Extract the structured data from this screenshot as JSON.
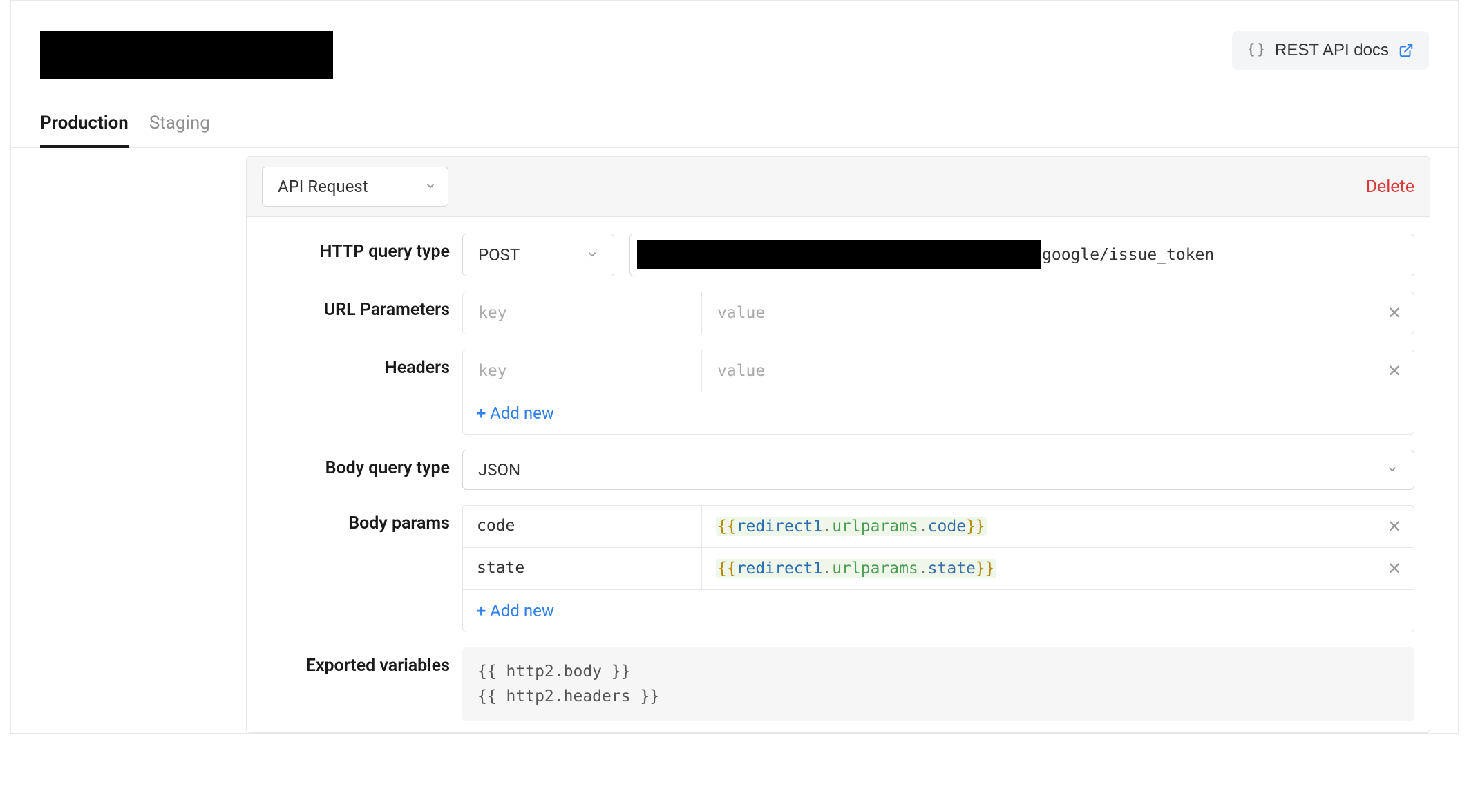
{
  "header": {
    "docs_label": "REST API docs"
  },
  "tabs": [
    {
      "label": "Production",
      "active": true
    },
    {
      "label": "Staging",
      "active": false
    }
  ],
  "panel": {
    "type_selector": "API Request",
    "delete_label": "Delete",
    "rows": {
      "http_query_type": {
        "label": "HTTP query type",
        "method": "POST",
        "url_suffix": "google/issue_token"
      },
      "url_parameters": {
        "label": "URL Parameters",
        "items": [
          {
            "key": "",
            "value": ""
          }
        ],
        "key_placeholder": "key",
        "value_placeholder": "value"
      },
      "headers": {
        "label": "Headers",
        "items": [
          {
            "key": "",
            "value": ""
          }
        ],
        "key_placeholder": "key",
        "value_placeholder": "value",
        "add_new_label": "Add new"
      },
      "body_query_type": {
        "label": "Body query type",
        "value": "JSON"
      },
      "body_params": {
        "label": "Body params",
        "items": [
          {
            "key": "code",
            "value_tokens": [
              "redirect1",
              "urlparams",
              "code"
            ],
            "raw": "{{redirect1.urlparams.code}}"
          },
          {
            "key": "state",
            "value_tokens": [
              "redirect1",
              "urlparams",
              "state"
            ],
            "raw": "{{redirect1.urlparams.state}}"
          }
        ],
        "add_new_label": "Add new"
      },
      "exported_variables": {
        "label": "Exported variables",
        "lines": [
          "{{ http2.body }}",
          "{{ http2.headers }}"
        ]
      }
    }
  }
}
